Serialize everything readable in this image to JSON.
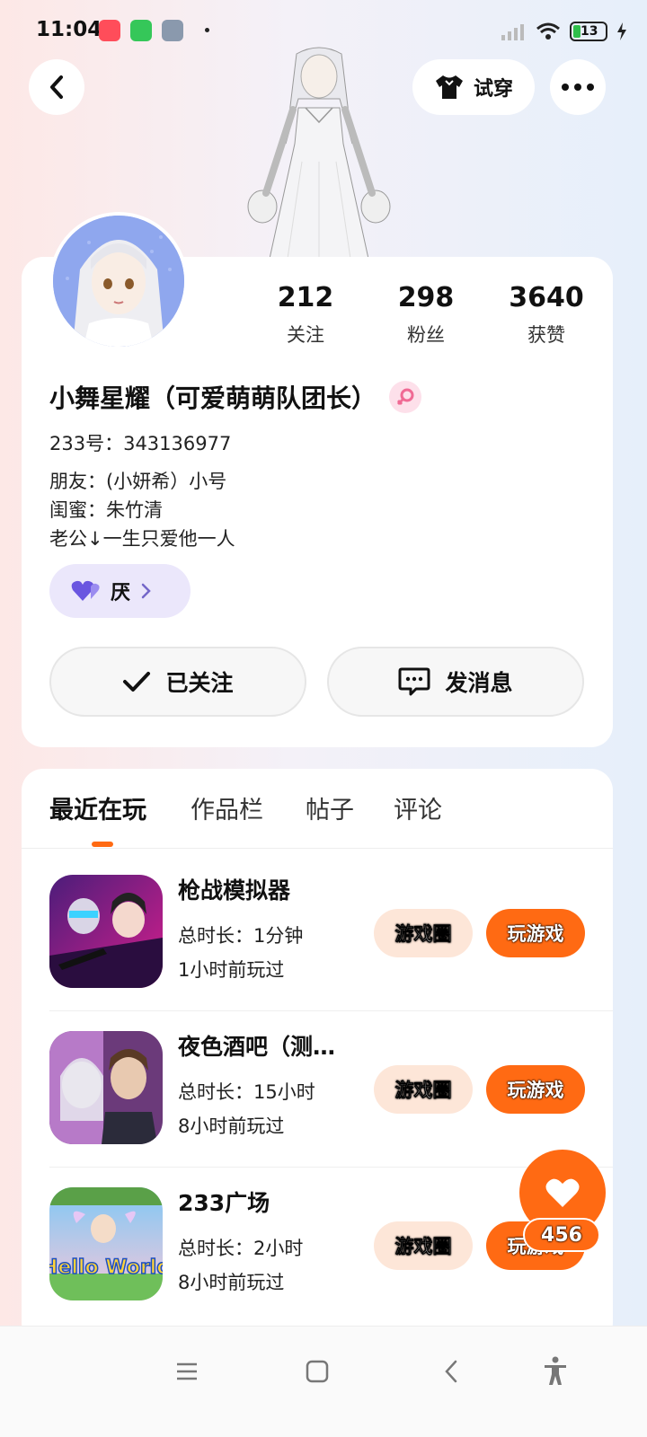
{
  "status_bar": {
    "time": "11:04",
    "battery": "13",
    "app_icons": [
      "video-app-icon",
      "android-app-icon",
      "settings-app-icon"
    ]
  },
  "header": {
    "back_icon": "chevron-left-icon",
    "tryon_label": "试穿",
    "more_icon": "more-dots-icon"
  },
  "profile": {
    "stats": [
      {
        "value": "212",
        "label": "关注"
      },
      {
        "value": "298",
        "label": "粉丝"
      },
      {
        "value": "3640",
        "label": "获赞"
      }
    ],
    "name": "小舞星耀（可爱萌萌队团长）",
    "gender_icon": "female-icon",
    "uid": "233号：343136977",
    "bio_lines": [
      "朋友：(小妍希）小号",
      "闺蜜：朱竹清",
      "老公↓一生只爱他一人"
    ],
    "badge_label": "厌",
    "follow_label": "已关注",
    "message_label": "发消息"
  },
  "tabs": [
    {
      "label": "最近在玩",
      "active": true
    },
    {
      "label": "作品栏",
      "active": false
    },
    {
      "label": "帖子",
      "active": false
    },
    {
      "label": "评论",
      "active": false
    }
  ],
  "games": [
    {
      "title": "枪战模拟器",
      "duration": "总时长：1分钟",
      "last_played": "1小时前玩过",
      "circle_label": "游戏圈",
      "play_label": "玩游戏"
    },
    {
      "title": "夜色酒吧（测…",
      "duration": "总时长：15小时",
      "last_played": "8小时前玩过",
      "circle_label": "游戏圈",
      "play_label": "玩游戏"
    },
    {
      "title": "233广场",
      "duration": "总时长：2小时",
      "last_played": "8小时前玩过",
      "circle_label": "游戏圈",
      "play_label": "玩游戏"
    }
  ],
  "game_icon_text": {
    "game3_overlay": "Hello World"
  },
  "like": {
    "count": "456"
  },
  "colors": {
    "accent": "#ff6a13",
    "badge_bg": "#ebe7fb",
    "pill_bg": "#fde6d8"
  }
}
